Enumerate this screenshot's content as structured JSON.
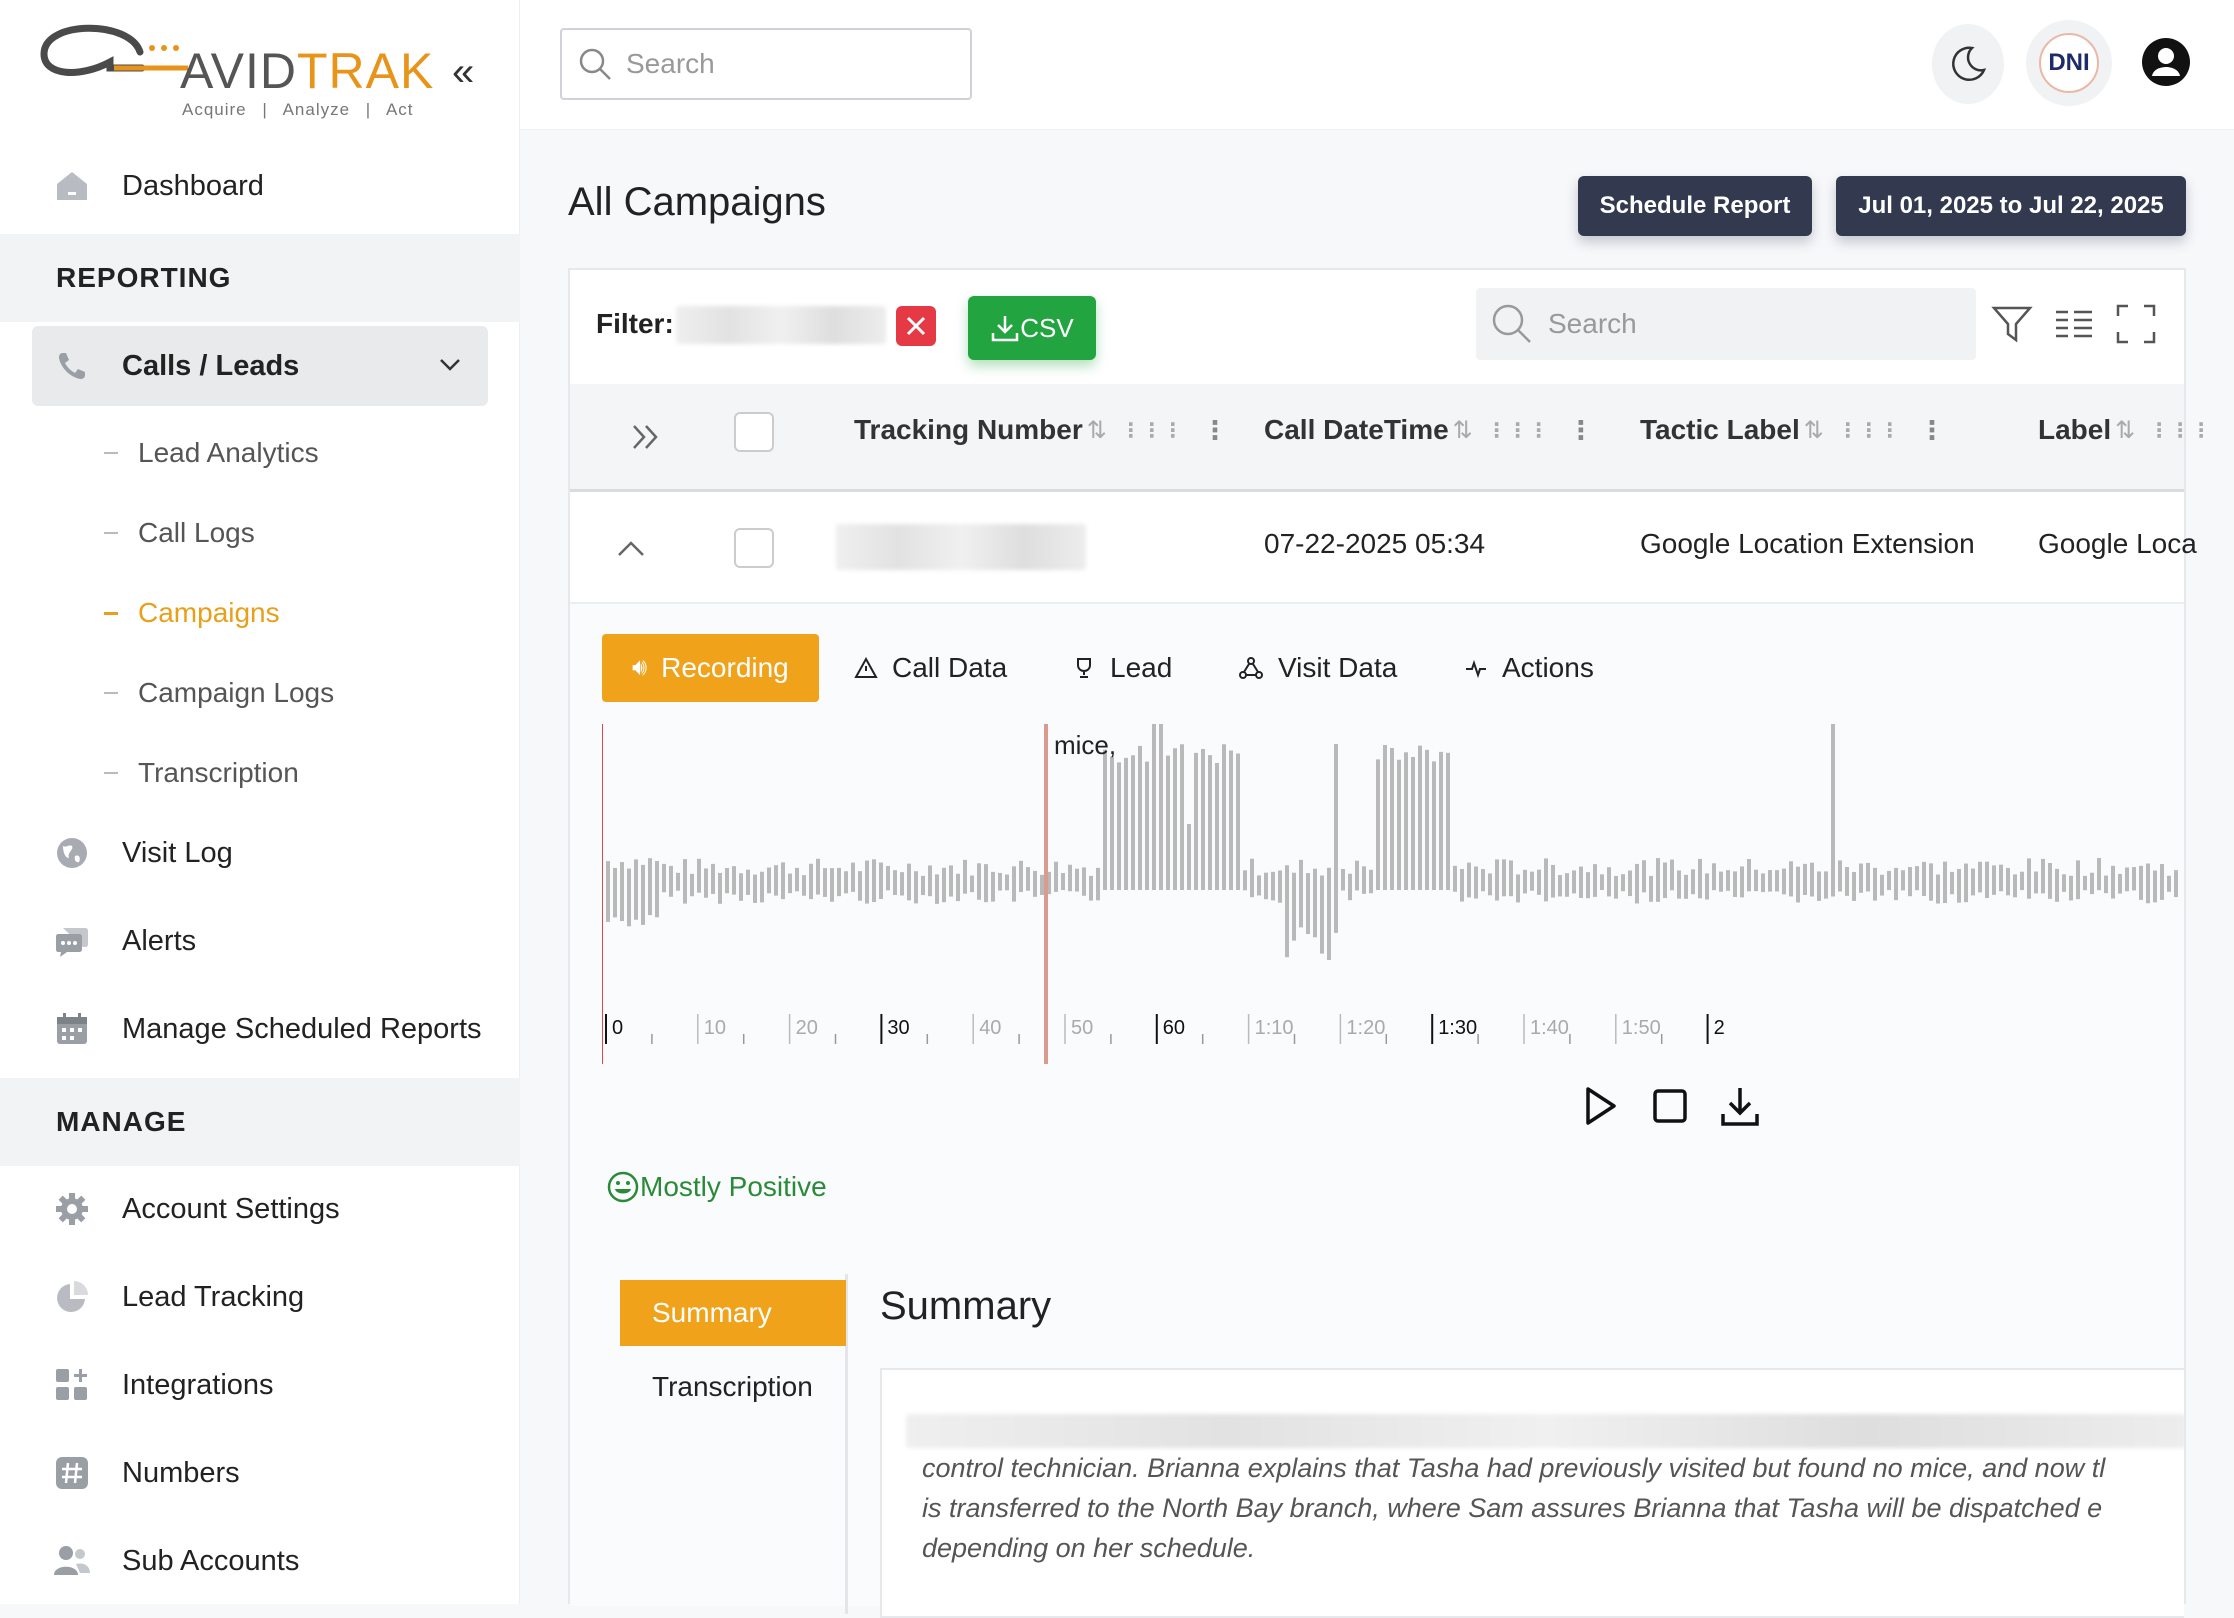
{
  "logo": {
    "word_a": "AVID",
    "word_b": "TRAK",
    "tagline": "Acquire | Analyze | Act"
  },
  "sidebar": {
    "dashboard": "Dashboard",
    "reporting_header": "REPORTING",
    "calls_leads": "Calls / Leads",
    "sub_items": [
      "Lead Analytics",
      "Call Logs",
      "Campaigns",
      "Campaign Logs",
      "Transcription"
    ],
    "active_sub": "Campaigns",
    "visit_log": "Visit Log",
    "alerts": "Alerts",
    "manage_scheduled": "Manage Scheduled Reports",
    "manage_header": "MANAGE",
    "account_settings": "Account Settings",
    "lead_tracking": "Lead Tracking",
    "integrations": "Integrations",
    "numbers": "Numbers",
    "sub_accounts": "Sub Accounts"
  },
  "topbar": {
    "search_placeholder": "Search",
    "dni_label": "DNI"
  },
  "page": {
    "title": "All Campaigns",
    "schedule_report": "Schedule Report",
    "date_range": "Jul 01, 2025 to Jul 22, 2025"
  },
  "table": {
    "filter_label": "Filter:",
    "csv_label": "CSV",
    "search_placeholder": "Search",
    "columns": [
      "Tracking Number",
      "Call DateTime",
      "Tactic Label",
      "Label"
    ],
    "row": {
      "call_datetime": "07-22-2025 05:34",
      "tactic_label": "Google Location Extension",
      "label": "Google Loca"
    }
  },
  "detail": {
    "tabs": [
      "Recording",
      "Call Data",
      "Lead",
      "Visit Data",
      "Actions"
    ],
    "wave_word": "mice,",
    "timeline_ticks": [
      "0",
      "10",
      "20",
      "30",
      "40",
      "50",
      "60",
      "1:10",
      "1:20",
      "1:30",
      "1:40",
      "1:50",
      "2"
    ],
    "sentiment": "Mostly Positive",
    "side_tabs": [
      "Summary",
      "Transcription"
    ],
    "summary_title": "Summary",
    "summary_lines": [
      "control technician. Brianna explains that Tasha had previously visited but found no mice, and now tl",
      "is transferred to the North Bay branch, where Sam assures Brianna that Tasha will be dispatched e",
      "depending on her schedule."
    ]
  },
  "colors": {
    "accent": "#f0a21b",
    "dark_button": "#333a4f",
    "csv_green": "#22a541",
    "danger": "#e53946",
    "positive": "#2a8a3a"
  }
}
